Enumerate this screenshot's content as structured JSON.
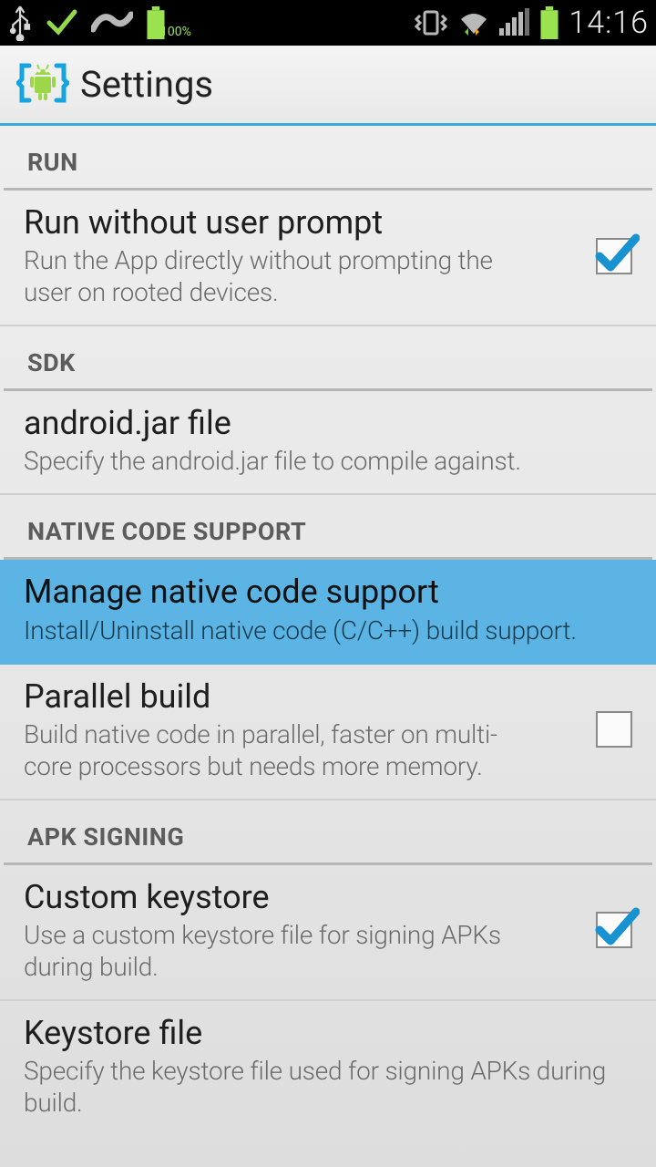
{
  "statusbar": {
    "battery_pct_text": "100%",
    "time": "14:16"
  },
  "header": {
    "title": "Settings"
  },
  "sections": {
    "run": {
      "label": "RUN",
      "item0": {
        "title": "Run without user prompt",
        "sub": "Run the App directly without prompting the user on rooted devices.",
        "checked": true
      }
    },
    "sdk": {
      "label": "SDK",
      "item0": {
        "title": "android.jar file",
        "sub": "Specify the android.jar file to compile against."
      }
    },
    "native": {
      "label": "NATIVE CODE SUPPORT",
      "item0": {
        "title": "Manage native code support",
        "sub": "Install/Uninstall native code (C/C++) build support."
      },
      "item1": {
        "title": "Parallel build",
        "sub": "Build native code in parallel, faster on multi-core processors but needs more memory.",
        "checked": false
      }
    },
    "apk": {
      "label": "APK SIGNING",
      "item0": {
        "title": "Custom keystore",
        "sub": "Use a custom keystore file for signing APKs during build.",
        "checked": true
      },
      "item1": {
        "title": "Keystore file",
        "sub": "Specify the keystore file used for signing APKs during build."
      }
    }
  }
}
